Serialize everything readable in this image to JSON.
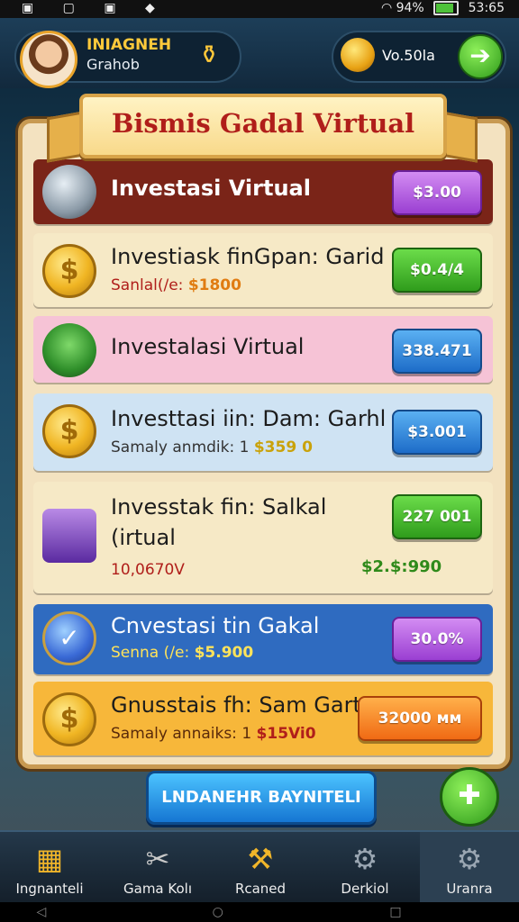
{
  "status": {
    "battery": "94%",
    "time": "53:65",
    "left_icons": "▣ ▢ ▣ ◆"
  },
  "profile": {
    "name": "INIAGNEH",
    "subtitle": "Grahob",
    "gift_icon": "gift-icon"
  },
  "currency": {
    "value": "Vo.50la",
    "go_icon": "➔"
  },
  "panel_title": "Bismis Gadal Virtual",
  "cards": [
    {
      "title": "Investasi Virtual",
      "value": "$3.00",
      "color": "purple",
      "bg": "#7a2418",
      "title_color": "#ffffff"
    },
    {
      "title": "Investiask finGpan: Garid",
      "sub_label": "Sanlal(/e:",
      "sub_value": "$1800",
      "value": "$0.4/4",
      "color": "green",
      "bg": "#f6e9c6"
    },
    {
      "title": "Investalasi Virtual",
      "value": "338.471",
      "color": "blue",
      "bg": "#f6c3d6"
    },
    {
      "title": "Investtasi iin: Dam: Garhl",
      "sub_label": "Samaly anmdik: 1",
      "sub_value": "$359 0",
      "value": "$3.001",
      "color": "blue",
      "bg": "#cfe3f3"
    },
    {
      "title": "Invesstak fin: Salkal",
      "title2": "(irtual",
      "sub_label": "10,0670V",
      "sub_value": "$2.$:990",
      "value": "227 001",
      "color": "green",
      "bg": "#f6e9c6"
    },
    {
      "title": "Cnvestasi tin Gakal",
      "sub_label": "Senna (/e:",
      "sub_value": "$5.900",
      "value": "30.0%",
      "color": "purple",
      "bg": "#2f6bc0",
      "title_color": "#ffffff"
    },
    {
      "title": "Gnusstais fh: Sam Gart",
      "sub_label": "Samaly annaiks: 1",
      "sub_value": "$15Vi0",
      "value": "32000 мм",
      "color": "orange",
      "bg": "#f7b73a"
    }
  ],
  "cta": "LNDANEHR BAYNITELI",
  "round_btn_icon": "✚",
  "nav": [
    {
      "label": "Ingnanteli",
      "icon": "▦"
    },
    {
      "label": "Gama Kolı",
      "icon": "✂"
    },
    {
      "label": "Rcaned",
      "icon": "⚒"
    },
    {
      "label": "Derkiol",
      "icon": "⚙"
    },
    {
      "label": "Uranra",
      "icon": "⚙"
    }
  ],
  "sysnav": "◁ ○ □"
}
